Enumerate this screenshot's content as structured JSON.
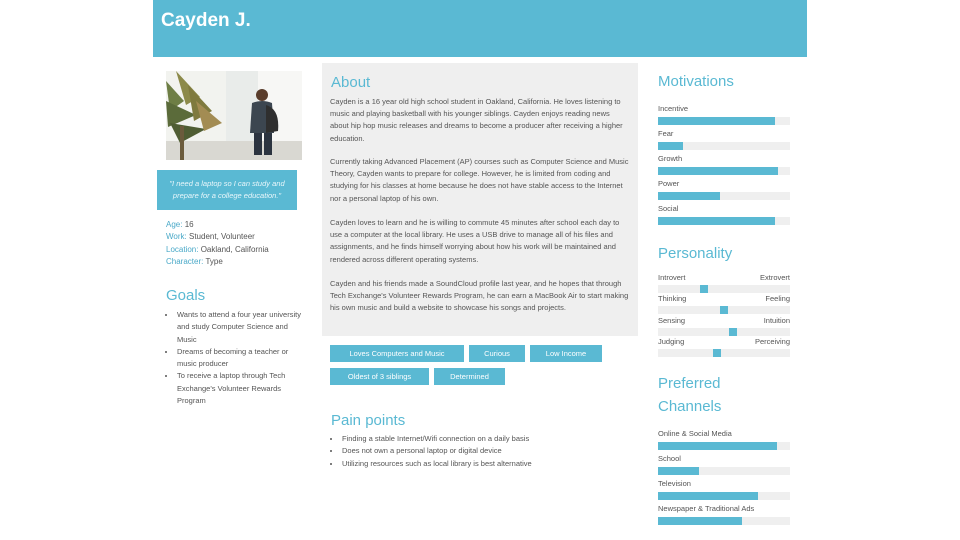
{
  "persona": {
    "name": "Cayden J."
  },
  "quote": "\"I need a laptop so I can study and prepare for a college education.\"",
  "facts": [
    {
      "key": "Age:",
      "value": "16"
    },
    {
      "key": "Work:",
      "value": "Student, Volunteer"
    },
    {
      "key": "Location:",
      "value": "Oakland, California"
    },
    {
      "key": "Character:",
      "value": "Type"
    }
  ],
  "goals": {
    "title": "Goals",
    "items": [
      "Wants to attend a four year university and study Computer Science and Music",
      "Dreams of becoming a teacher or music producer",
      "To receive a laptop through Tech Exchange's Volunteer Rewards Program"
    ]
  },
  "about": {
    "title": "About",
    "paragraphs": [
      "Cayden is a 16 year old high school student in Oakland, California. He loves listening to music and playing basketball with his younger siblings. Cayden enjoys reading news about hip hop music releases and dreams to become a producer after receiving a higher education.",
      "Currently taking Advanced Placement (AP) courses such as Computer Science and Music Theory, Cayden wants to prepare for college. However, he is limited from coding and studying for his classes at home because he does not have stable access to the Internet nor a personal laptop of his own.",
      "Cayden loves to learn and he is willing to commute 45 minutes after school each day to use a computer at the local library. He uses a USB drive to manage all of his files and assignments, and he finds himself worrying about how his work will be maintained and rendered across different operating systems.",
      "Cayden and his friends made a SoundCloud profile last year, and he hopes that through Tech Exchange's Volunteer Rewards Program, he can earn a MacBook Air to start making his own music and build a website to showcase his songs and projects."
    ]
  },
  "tags": [
    "Loves Computers and Music",
    "Curious",
    "Low Income",
    "Oldest of 3 siblings",
    "Determined"
  ],
  "pain_points": {
    "title": "Pain points",
    "items": [
      "Finding a stable Internet/Wifi connection on a daily basis",
      "Does not own a personal laptop or digital device",
      "Utilizing resources such as local library is best alternative"
    ]
  },
  "motivations": {
    "title": "Motivations",
    "items": [
      {
        "label": "Incentive",
        "value": 0.89
      },
      {
        "label": "Fear",
        "value": 0.19
      },
      {
        "label": "Growth",
        "value": 0.91
      },
      {
        "label": "Power",
        "value": 0.47
      },
      {
        "label": "Social",
        "value": 0.89
      }
    ]
  },
  "personality": {
    "title": "Personality",
    "items": [
      {
        "left": "Introvert",
        "right": "Extrovert",
        "value": 0.35
      },
      {
        "left": "Thinking",
        "right": "Feeling",
        "value": 0.5
      },
      {
        "left": "Sensing",
        "right": "Intuition",
        "value": 0.57
      },
      {
        "left": "Judging",
        "right": "Perceiving",
        "value": 0.45
      }
    ]
  },
  "channels": {
    "title_line1": "Preferred",
    "title_line2": "Channels",
    "items": [
      {
        "label": "Online & Social Media",
        "value": 0.9
      },
      {
        "label": "School",
        "value": 0.31
      },
      {
        "label": "Television",
        "value": 0.76
      },
      {
        "label": "Newspaper & Traditional Ads",
        "value": 0.64
      }
    ]
  }
}
